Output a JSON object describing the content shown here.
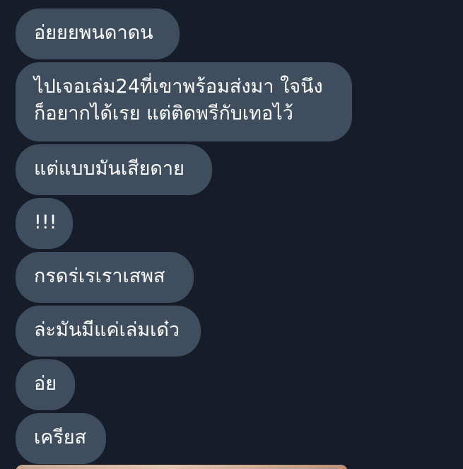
{
  "messages": [
    {
      "lines": [
        "อ่ยยยพนดาดน"
      ]
    },
    {
      "lines": [
        "ไปเจอเล่ม24ที่เขาพร้อมส่งมา ใจนึง",
        "ก็อยากได้เรย แต่ติดพรีกับเทอไว้"
      ]
    },
    {
      "lines": [
        "แต่แบบมันเสียดาย"
      ]
    },
    {
      "lines": [
        "!!!"
      ]
    },
    {
      "lines": [
        "กรดร่เรเราเสพส"
      ]
    },
    {
      "lines": [
        "ล่ะมันมีแค่เล่มเด๋ว"
      ]
    },
    {
      "lines": [
        "อ่ย"
      ]
    },
    {
      "lines": [
        "เครียส"
      ]
    }
  ],
  "colors": {
    "background": "#161d28",
    "bubble": "#3f4e5f",
    "text": "#ffffff"
  }
}
